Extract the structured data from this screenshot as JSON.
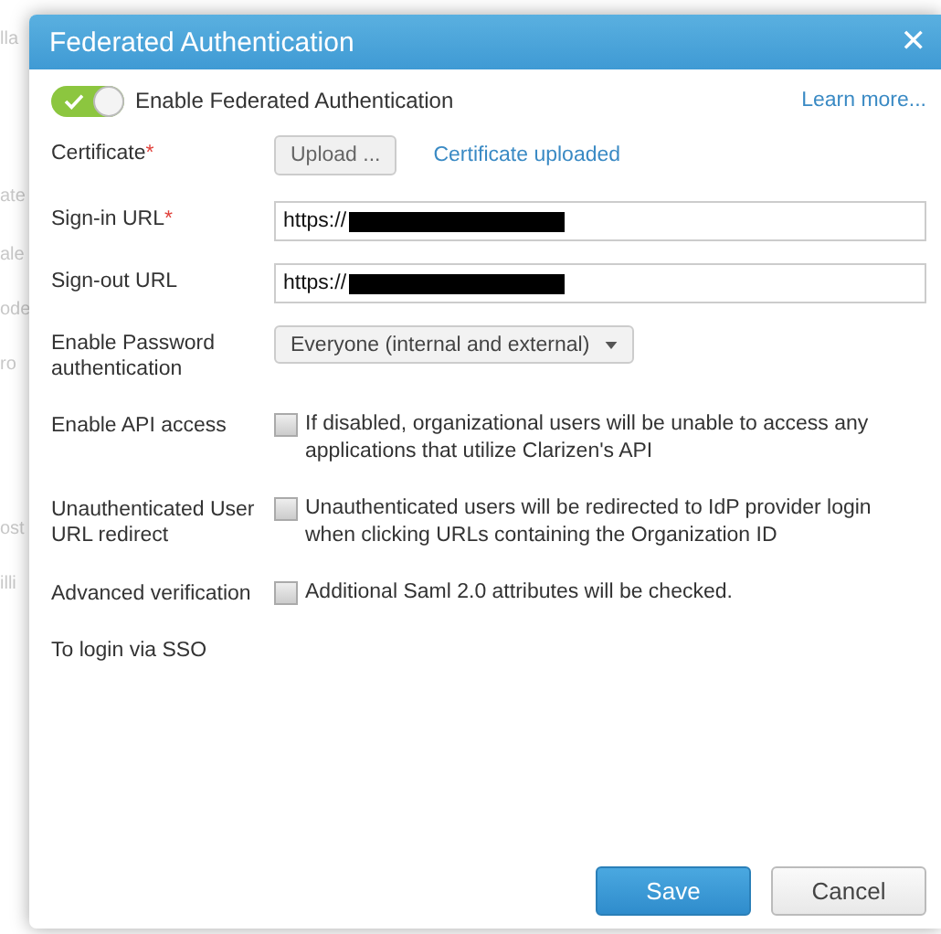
{
  "background_fragments": [
    "lla",
    "ate",
    "ale",
    "ode",
    "ro",
    "ost",
    "illi"
  ],
  "dialog": {
    "title": "Federated Authentication",
    "close": "✕"
  },
  "toggle": {
    "label": "Enable Federated Authentication",
    "on": true
  },
  "learn_more": "Learn more...",
  "fields": [
    {
      "kind": "upload",
      "label": "Certificate",
      "mark": "*",
      "button": "Upload ...",
      "status": "Certificate uploaded"
    },
    {
      "kind": "text",
      "label": "Sign-in URL",
      "mark": "*",
      "value": "https://",
      "redacted": true
    },
    {
      "kind": "text",
      "label": "Sign-out URL",
      "value": "https://",
      "redacted": true
    },
    {
      "kind": "select",
      "label": "Enable Password authentication",
      "value": "Everyone (internal and external)"
    },
    {
      "kind": "checkbox",
      "label": "Enable API access",
      "checked": false,
      "text": "If disabled, organizational users will be unable to access any applications that utilize Clarizen's API"
    },
    {
      "kind": "checkbox",
      "label": "Unauthenticated User URL redirect",
      "checked": false,
      "text": "Unauthenticated users will be redirected to IdP provider login when clicking URLs containing the Organization ID"
    },
    {
      "kind": "checkbox",
      "label": "Advanced verification",
      "checked": false,
      "text": "Additional Saml 2.0 attributes will be checked."
    },
    {
      "kind": "info",
      "label": "To login via SSO"
    }
  ],
  "buttons": [
    {
      "label": "Save",
      "kind": "primary"
    },
    {
      "label": "Cancel",
      "kind": "secondary"
    }
  ]
}
